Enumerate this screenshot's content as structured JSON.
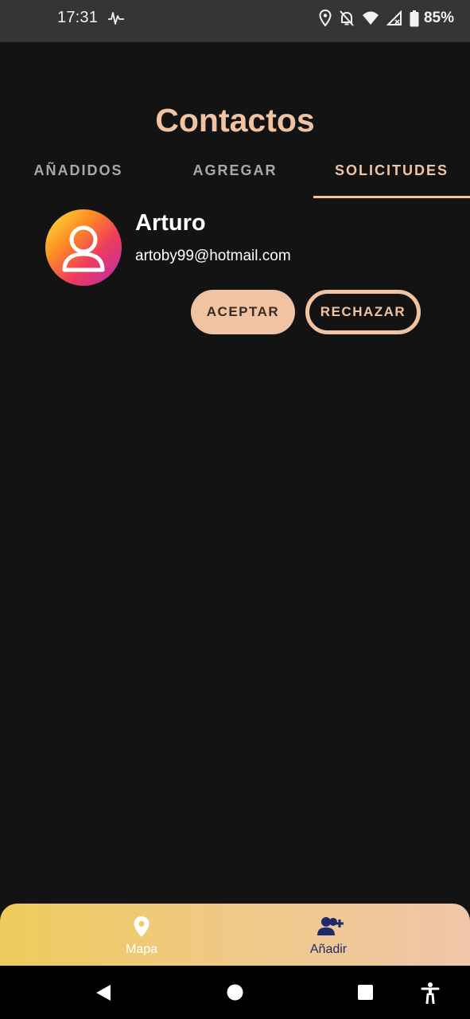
{
  "status_bar": {
    "time": "17:31",
    "battery_percent": "85%",
    "icons": [
      "pulse-icon",
      "location-icon",
      "notifications-off-icon",
      "wifi-icon",
      "signal-icon",
      "battery-icon"
    ]
  },
  "page": {
    "title": "Contactos"
  },
  "tabs": [
    {
      "label": "AÑADIDOS",
      "selected": false
    },
    {
      "label": "AGREGAR",
      "selected": false
    },
    {
      "label": "SOLICITUDES",
      "selected": true
    }
  ],
  "requests": [
    {
      "name": "Arturo",
      "email": "artoby99@hotmail.com",
      "avatar_icon": "user-icon",
      "accept_label": "ACEPTAR",
      "reject_label": "RECHAZAR"
    }
  ],
  "bottom_nav": [
    {
      "label": "Mapa",
      "icon": "map-pin-icon"
    },
    {
      "label": "Añadir",
      "icon": "add-person-icon"
    }
  ],
  "system_nav": {
    "icons": [
      "back-icon",
      "home-icon",
      "recents-icon",
      "accessibility-icon"
    ]
  },
  "colors": {
    "background": "#141314",
    "accent": "#f0c4a3",
    "status_bar": "#353535",
    "nav_label_active": "#ffffff",
    "nav_label_inactive": "#1f2a6b"
  }
}
